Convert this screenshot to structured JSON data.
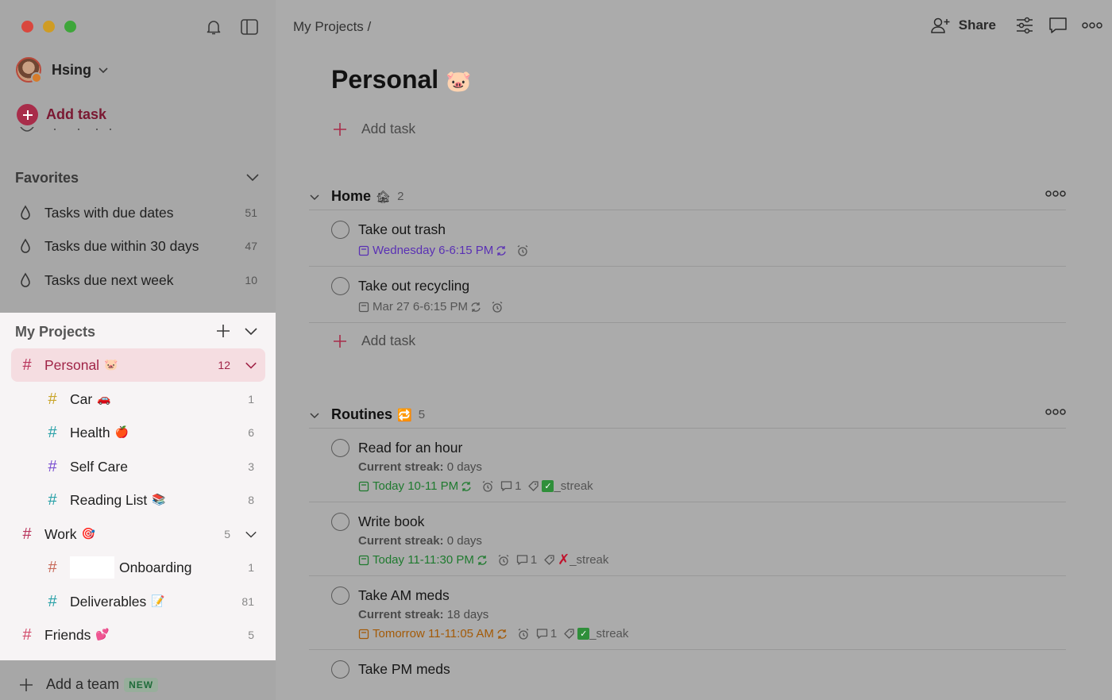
{
  "window": {
    "traffic_lights": [
      "close",
      "minimize",
      "zoom"
    ]
  },
  "sidebar": {
    "user_name": "Hsing",
    "add_task_label": "Add task",
    "favorites": {
      "title": "Favorites",
      "items": [
        {
          "label": "Tasks with due dates",
          "count": "51"
        },
        {
          "label": "Tasks due within 30 days",
          "count": "47"
        },
        {
          "label": "Tasks due next week",
          "count": "10"
        }
      ]
    },
    "projects": {
      "title": "My Projects",
      "items": [
        {
          "label": "Personal",
          "emoji": "🐷",
          "count": "12",
          "hash_color": "#b8325a",
          "active": true
        },
        {
          "label": "Car",
          "emoji": "🚗",
          "count": "1",
          "hash_color": "#c9a52a"
        },
        {
          "label": "Health",
          "emoji": "🍎",
          "count": "6",
          "hash_color": "#2aa1a8"
        },
        {
          "label": "Self Care",
          "emoji": "",
          "count": "3",
          "hash_color": "#7a4fd0"
        },
        {
          "label": "Reading List",
          "emoji": "📚",
          "count": "8",
          "hash_color": "#2aa1a8"
        },
        {
          "label": "Work",
          "emoji": "🎯",
          "count": "5",
          "hash_color": "#b8325a"
        },
        {
          "label": "Onboarding",
          "emoji": "",
          "count": "1",
          "hash_color": "#c76a5a"
        },
        {
          "label": "Deliverables",
          "emoji": "📝",
          "count": "81",
          "hash_color": "#2aa1a8"
        },
        {
          "label": "Friends",
          "emoji": "💕",
          "count": "5",
          "hash_color": "#d24a6a"
        }
      ]
    },
    "add_team_label": "Add a team",
    "new_badge": "NEW"
  },
  "header": {
    "breadcrumb": "My Projects /",
    "share_label": "Share"
  },
  "main": {
    "title": "Personal",
    "title_emoji": "🐷",
    "add_task_label": "Add task",
    "sections": [
      {
        "title": "Home",
        "emoji": "🏚",
        "count": "2",
        "tasks": [
          {
            "title": "Take out trash",
            "due": "Wednesday 6-6:15 PM",
            "due_color": "purple"
          },
          {
            "title": "Take out recycling",
            "due": "Mar 27 6-6:15 PM",
            "due_color": "grey"
          }
        ],
        "add_task_label": "Add task"
      },
      {
        "title": "Routines",
        "emoji": "🔁",
        "count": "5",
        "tasks": [
          {
            "title": "Read for an hour",
            "desc_label": "Current streak:",
            "desc_value": "0 days",
            "due": "Today 10-11 PM",
            "due_color": "green",
            "comments": "1",
            "label": "_streak",
            "label_mark": "ok"
          },
          {
            "title": "Write book",
            "desc_label": "Current streak:",
            "desc_value": "0 days",
            "due": "Today 11-11:30 PM",
            "due_color": "green",
            "comments": "1",
            "label": "_streak",
            "label_mark": "x"
          },
          {
            "title": "Take AM meds",
            "desc_label": "Current streak:",
            "desc_value": "18 days",
            "due": "Tomorrow 11-11:05 AM",
            "due_color": "orange",
            "comments": "1",
            "label": "_streak",
            "label_mark": "ok"
          },
          {
            "title": "Take PM meds"
          }
        ]
      }
    ]
  }
}
